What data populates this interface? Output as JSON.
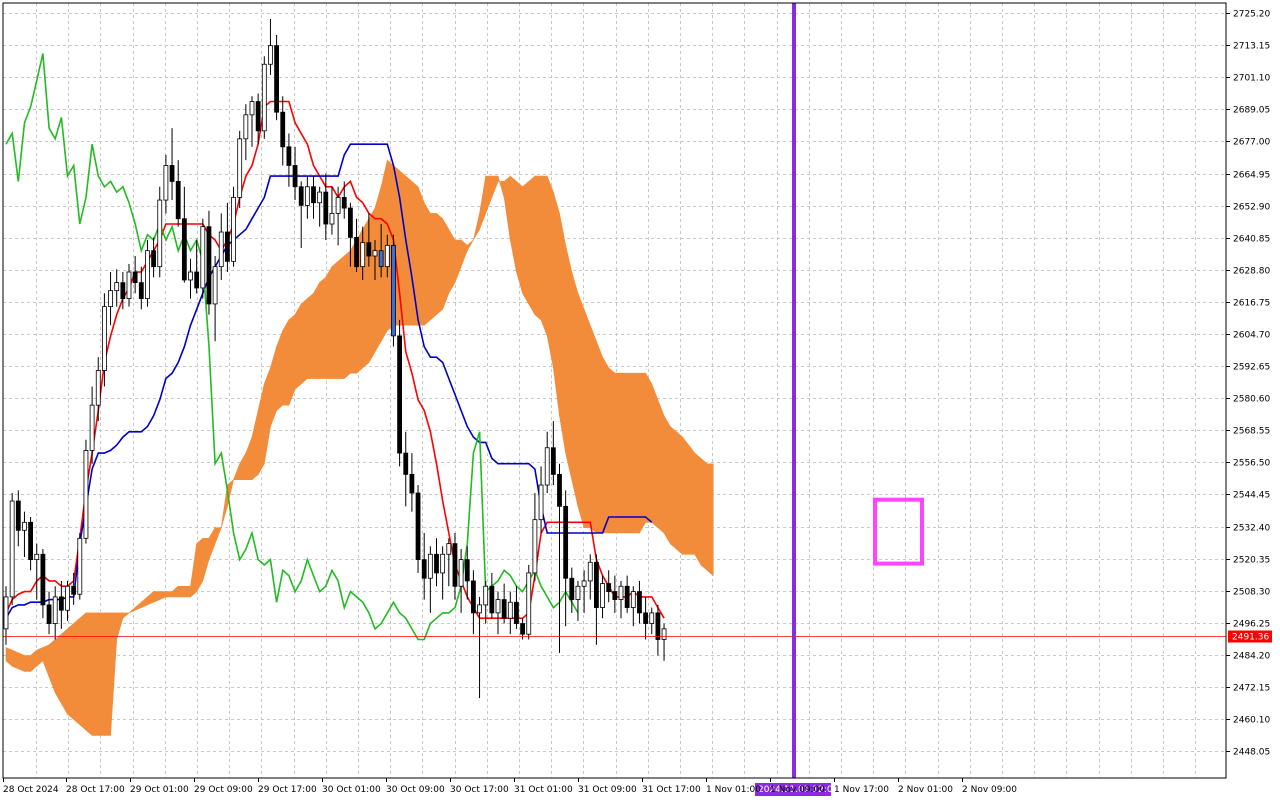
{
  "chart_data": {
    "type": "candlestick",
    "indicator": "Ichimoku Kinko Hyo",
    "grid": true,
    "y_axis": {
      "side": "right",
      "ticks": [
        "2725.20",
        "2713.15",
        "2701.10",
        "2689.05",
        "2677.00",
        "2664.95",
        "2652.90",
        "2640.85",
        "2628.80",
        "2616.75",
        "2604.70",
        "2592.65",
        "2580.60",
        "2568.55",
        "2556.50",
        "2544.45",
        "2532.40",
        "2520.35",
        "2508.30",
        "2496.25",
        "2484.20",
        "2472.15",
        "2460.10",
        "2448.05"
      ],
      "range": [
        2438.0,
        2729.0
      ]
    },
    "x_axis": {
      "ticks": [
        "28 Oct 2024",
        "28 Oct 17:00",
        "29 Oct 01:00",
        "29 Oct 09:00",
        "29 Oct 17:00",
        "30 Oct 01:00",
        "30 Oct 09:00",
        "30 Oct 17:00",
        "31 Oct 01:00",
        "31 Oct 09:00",
        "31 Oct 17:00",
        "1 Nov 01:00",
        "1 Nov 09:00",
        "1 Nov 17:00",
        "2 Nov 01:00",
        "2 Nov 09:00"
      ]
    },
    "current_price": {
      "label": "2491.36",
      "value": 2491.36,
      "color": "#ff0000"
    },
    "vertical_marker": {
      "label": "2024.11.01 12:00",
      "color": "#8a2be2"
    },
    "highlight_box": {
      "color": "#ff44ff",
      "price_low": 2518.5,
      "price_high": 2542.5
    },
    "candles": [
      [
        2494,
        2510,
        2488,
        2506
      ],
      [
        2506,
        2545,
        2503,
        2542
      ],
      [
        2542,
        2546,
        2525,
        2531
      ],
      [
        2531,
        2538,
        2521,
        2534
      ],
      [
        2534,
        2536,
        2516,
        2520
      ],
      [
        2520,
        2526,
        2505,
        2522
      ],
      [
        2522,
        2524,
        2498,
        2503
      ],
      [
        2503,
        2508,
        2492,
        2496
      ],
      [
        2496,
        2510,
        2490,
        2506
      ],
      [
        2506,
        2512,
        2494,
        2501
      ],
      [
        2501,
        2512,
        2497,
        2510
      ],
      [
        2510,
        2515,
        2503,
        2507
      ],
      [
        2507,
        2530,
        2505,
        2528
      ],
      [
        2528,
        2565,
        2526,
        2561
      ],
      [
        2561,
        2585,
        2556,
        2578
      ],
      [
        2578,
        2596,
        2572,
        2591
      ],
      [
        2591,
        2620,
        2585,
        2615
      ],
      [
        2615,
        2628,
        2608,
        2621
      ],
      [
        2621,
        2629,
        2615,
        2624
      ],
      [
        2624,
        2628,
        2614,
        2618
      ],
      [
        2618,
        2631,
        2615,
        2628
      ],
      [
        2628,
        2634,
        2620,
        2624
      ],
      [
        2624,
        2630,
        2614,
        2618
      ],
      [
        2618,
        2640,
        2615,
        2636
      ],
      [
        2636,
        2641,
        2626,
        2630
      ],
      [
        2630,
        2660,
        2626,
        2655
      ],
      [
        2655,
        2672,
        2650,
        2668
      ],
      [
        2668,
        2682,
        2655,
        2662
      ],
      [
        2662,
        2670,
        2645,
        2648
      ],
      [
        2648,
        2660,
        2624,
        2625
      ],
      [
        2625,
        2633,
        2618,
        2628
      ],
      [
        2628,
        2640,
        2620,
        2622
      ],
      [
        2622,
        2648,
        2618,
        2645
      ],
      [
        2645,
        2651,
        2612,
        2616
      ],
      [
        2616,
        2634,
        2602,
        2630
      ],
      [
        2630,
        2650,
        2625,
        2643
      ],
      [
        2643,
        2654,
        2628,
        2632
      ],
      [
        2632,
        2660,
        2630,
        2656
      ],
      [
        2656,
        2681,
        2652,
        2678
      ],
      [
        2678,
        2691,
        2670,
        2687
      ],
      [
        2687,
        2694,
        2675,
        2692
      ],
      [
        2692,
        2695,
        2676,
        2681
      ],
      [
        2681,
        2709,
        2678,
        2706
      ],
      [
        2706,
        2723,
        2702,
        2713
      ],
      [
        2713,
        2717,
        2685,
        2688
      ],
      [
        2688,
        2694,
        2668,
        2675
      ],
      [
        2675,
        2680,
        2660,
        2668
      ],
      [
        2668,
        2675,
        2655,
        2660
      ],
      [
        2660,
        2662,
        2637,
        2653
      ],
      [
        2653,
        2664,
        2648,
        2660
      ],
      [
        2660,
        2664,
        2648,
        2654
      ],
      [
        2654,
        2660,
        2645,
        2658
      ],
      [
        2658,
        2665,
        2640,
        2646
      ],
      [
        2646,
        2660,
        2642,
        2650
      ],
      [
        2650,
        2660,
        2638,
        2656
      ],
      [
        2656,
        2662,
        2648,
        2652
      ],
      [
        2652,
        2654,
        2630,
        2641
      ],
      [
        2641,
        2648,
        2628,
        2630
      ],
      [
        2630,
        2645,
        2625,
        2639
      ],
      [
        2639,
        2650,
        2630,
        2634
      ],
      [
        2634,
        2640,
        2625,
        2636
      ],
      [
        2636,
        2646,
        2626,
        2630
      ],
      [
        2630,
        2642,
        2626,
        2638
      ],
      [
        2638,
        2642,
        2600,
        2604
      ],
      [
        2604,
        2610,
        2555,
        2560
      ],
      [
        2560,
        2568,
        2540,
        2552
      ],
      [
        2552,
        2560,
        2538,
        2545
      ],
      [
        2545,
        2548,
        2515,
        2520
      ],
      [
        2520,
        2530,
        2505,
        2513
      ],
      [
        2513,
        2525,
        2500,
        2522
      ],
      [
        2522,
        2528,
        2510,
        2515
      ],
      [
        2515,
        2525,
        2505,
        2522
      ],
      [
        2522,
        2528,
        2510,
        2526
      ],
      [
        2526,
        2530,
        2505,
        2510
      ],
      [
        2510,
        2524,
        2500,
        2520
      ],
      [
        2520,
        2525,
        2505,
        2512
      ],
      [
        2512,
        2516,
        2492,
        2500
      ],
      [
        2500,
        2506,
        2468,
        2503
      ],
      [
        2503,
        2512,
        2496,
        2510
      ],
      [
        2510,
        2515,
        2498,
        2500
      ],
      [
        2500,
        2508,
        2492,
        2505
      ],
      [
        2505,
        2511,
        2496,
        2498
      ],
      [
        2498,
        2508,
        2492,
        2504
      ],
      [
        2504,
        2510,
        2494,
        2496
      ],
      [
        2496,
        2498,
        2490,
        2492
      ],
      [
        2492,
        2518,
        2490,
        2515
      ],
      [
        2515,
        2545,
        2512,
        2535
      ],
      [
        2535,
        2555,
        2530,
        2548
      ],
      [
        2548,
        2568,
        2545,
        2562
      ],
      [
        2562,
        2572,
        2548,
        2552
      ],
      [
        2552,
        2556,
        2485,
        2540
      ],
      [
        2540,
        2546,
        2495,
        2513
      ],
      [
        2513,
        2517,
        2500,
        2505
      ],
      [
        2505,
        2512,
        2497,
        2510
      ],
      [
        2510,
        2516,
        2500,
        2512
      ],
      [
        2512,
        2522,
        2505,
        2519
      ],
      [
        2519,
        2522,
        2488,
        2502
      ],
      [
        2502,
        2514,
        2498,
        2511
      ],
      [
        2511,
        2516,
        2504,
        2508
      ],
      [
        2508,
        2514,
        2500,
        2505
      ],
      [
        2505,
        2512,
        2498,
        2510
      ],
      [
        2510,
        2514,
        2500,
        2502
      ],
      [
        2502,
        2510,
        2495,
        2508
      ],
      [
        2508,
        2512,
        2496,
        2500
      ],
      [
        2500,
        2506,
        2490,
        2496
      ],
      [
        2496,
        2502,
        2492,
        2500
      ],
      [
        2500,
        2503,
        2484,
        2490
      ],
      [
        2490,
        2496,
        2482,
        2494
      ]
    ],
    "series": [
      {
        "type": "line",
        "color": "#ff0000",
        "values": [
          2500,
          2505,
          2507,
          2508,
          2508,
          2512,
          2514,
          2512,
          2512,
          2510,
          2510,
          2512,
          2528,
          2546,
          2560,
          2576,
          2594,
          2604,
          2612,
          2618,
          2622,
          2628,
          2628,
          2632,
          2636,
          2640,
          2646,
          2646,
          2646,
          2646,
          2646,
          2646,
          2646,
          2642,
          2640,
          2636,
          2640,
          2646,
          2656,
          2664,
          2668,
          2676,
          2690,
          2692,
          2692,
          2692,
          2692,
          2684,
          2680,
          2676,
          2668,
          2664,
          2660,
          2660,
          2656,
          2660,
          2662,
          2656,
          2654,
          2650,
          2648,
          2648,
          2646,
          2640,
          2620,
          2598,
          2590,
          2580,
          2576,
          2568,
          2556,
          2542,
          2530,
          2518,
          2512,
          2506,
          2502,
          2498,
          2498,
          2498,
          2498,
          2498,
          2498,
          2498,
          2498,
          2500,
          2514,
          2530,
          2534,
          2534,
          2534,
          2534,
          2534,
          2534,
          2534,
          2534,
          2520,
          2514,
          2510,
          2506,
          2506,
          2506,
          2508,
          2506,
          2506,
          2506,
          2502,
          2498
        ],
        "offset": 0
      },
      {
        "type": "line",
        "color": "#0000cc",
        "values": [
          2498,
          2502,
          2503,
          2503,
          2504,
          2504,
          2504,
          2505,
          2505,
          2505,
          2506,
          2506,
          2526,
          2540,
          2554,
          2560,
          2560,
          2561,
          2563,
          2566,
          2568,
          2568,
          2568,
          2570,
          2574,
          2580,
          2588,
          2590,
          2594,
          2600,
          2608,
          2614,
          2620,
          2626,
          2630,
          2634,
          2638,
          2640,
          2642,
          2644,
          2648,
          2652,
          2656,
          2664,
          2664,
          2664,
          2664,
          2664,
          2664,
          2664,
          2664,
          2664,
          2664,
          2664,
          2664,
          2672,
          2676,
          2676,
          2676,
          2676,
          2676,
          2676,
          2676,
          2668,
          2656,
          2640,
          2626,
          2610,
          2600,
          2596,
          2596,
          2594,
          2588,
          2582,
          2576,
          2570,
          2566,
          2564,
          2564,
          2558,
          2556,
          2556,
          2556,
          2556,
          2556,
          2556,
          2554,
          2540,
          2530,
          2530,
          2530,
          2530,
          2530,
          2530,
          2530,
          2530,
          2530,
          2530,
          2536,
          2536,
          2536,
          2536,
          2536,
          2536,
          2536,
          2534
        ],
        "offset": 0
      },
      {
        "type": "line",
        "color": "#22bb22",
        "values": [
          2626,
          2628,
          2618,
          2630,
          2640,
          2636,
          2652,
          2644,
          2656,
          2636,
          2630,
          2626,
          2630,
          2640,
          2624,
          2630,
          2636,
          2642,
          2634,
          2642,
          2660,
          2668,
          2688,
          2684,
          2676,
          2670,
          2676,
          2680,
          2662,
          2684,
          2690,
          2700,
          2710,
          2682,
          2678,
          2686,
          2664,
          2668,
          2646,
          2656,
          2676,
          2664,
          2660,
          2662,
          2658,
          2660,
          2654,
          2646,
          2636,
          2642,
          2640,
          2646,
          2640,
          2645,
          2636,
          2642,
          2636,
          2640,
          2632,
          2600,
          2556,
          2560,
          2546,
          2530,
          2520,
          2524,
          2530,
          2520,
          2518,
          2520,
          2504,
          2516,
          2514,
          2508,
          2512,
          2520,
          2514,
          2508,
          2510,
          2516,
          2512,
          2502,
          2508,
          2506,
          2504,
          2500,
          2494,
          2496,
          2500,
          2504,
          2500,
          2498,
          2494,
          2490,
          2490,
          2496,
          2498,
          2500,
          2500,
          2502,
          2510,
          2526,
          2560,
          2568,
          2508,
          2510,
          2512,
          2516,
          2514,
          2510,
          2508,
          2512,
          2516,
          2510,
          2506,
          2502,
          2504,
          2508,
          2504,
          2500
        ],
        "offset": -26
      },
      {
        "type": "cloud",
        "colors": {
          "bull": "#f28c3a",
          "bear": "#d4aee0"
        },
        "span_a": [
          2487,
          2486,
          2485,
          2484,
          2484,
          2486,
          2487,
          2488,
          2490,
          2492,
          2494,
          2496,
          2498,
          2500,
          2500,
          2500,
          2500,
          2500,
          2500,
          2500,
          2500,
          2501,
          2502,
          2503,
          2504,
          2505,
          2506,
          2506,
          2506,
          2506,
          2506,
          2508,
          2512,
          2520,
          2526,
          2532,
          2540,
          2550,
          2556,
          2560,
          2566,
          2576,
          2586,
          2592,
          2600,
          2606,
          2610,
          2612,
          2616,
          2618,
          2620,
          2624,
          2626,
          2630,
          2632,
          2634,
          2636,
          2640,
          2644,
          2648,
          2652,
          2660,
          2670,
          2668,
          2666,
          2664,
          2662,
          2660,
          2654,
          2650,
          2650,
          2648,
          2644,
          2640,
          2640,
          2638,
          2640,
          2644,
          2650,
          2656,
          2662,
          2662,
          2664,
          2662,
          2660,
          2662,
          2664,
          2664,
          2664,
          2658,
          2650,
          2638,
          2628,
          2620,
          2614,
          2608,
          2602,
          2596,
          2592,
          2590,
          2590,
          2590,
          2590,
          2590,
          2590,
          2586,
          2580,
          2574,
          2570,
          2568,
          2566,
          2563,
          2560,
          2558,
          2556,
          2556
        ],
        "span_b": [
          2482,
          2480,
          2479,
          2478,
          2478,
          2480,
          2482,
          2476,
          2470,
          2466,
          2462,
          2460,
          2458,
          2456,
          2454,
          2454,
          2454,
          2454,
          2490,
          2498,
          2500,
          2502,
          2504,
          2506,
          2508,
          2508,
          2508,
          2508,
          2510,
          2510,
          2510,
          2526,
          2528,
          2528,
          2532,
          2532,
          2548,
          2550,
          2550,
          2550,
          2550,
          2552,
          2556,
          2570,
          2576,
          2578,
          2578,
          2584,
          2586,
          2588,
          2588,
          2588,
          2588,
          2588,
          2588,
          2588,
          2590,
          2590,
          2592,
          2594,
          2598,
          2602,
          2606,
          2608,
          2608,
          2608,
          2608,
          2608,
          2608,
          2610,
          2612,
          2614,
          2620,
          2624,
          2630,
          2636,
          2640,
          2650,
          2664,
          2664,
          2664,
          2656,
          2640,
          2628,
          2620,
          2616,
          2612,
          2610,
          2604,
          2592,
          2574,
          2560,
          2550,
          2540,
          2532,
          2532,
          2530,
          2530,
          2530,
          2530,
          2530,
          2530,
          2530,
          2530,
          2534,
          2534,
          2532,
          2530,
          2526,
          2524,
          2522,
          2522,
          2522,
          2518,
          2516,
          2514
        ],
        "offset": 26
      }
    ]
  },
  "colors": {
    "background": "#ffffff",
    "grid": "#c8c8c8",
    "bull_candle_fill": "#ffffff",
    "bear_candle_fill": "#000000",
    "candle_outline": "#000000",
    "highlight_candle": "#3b6fd8"
  }
}
